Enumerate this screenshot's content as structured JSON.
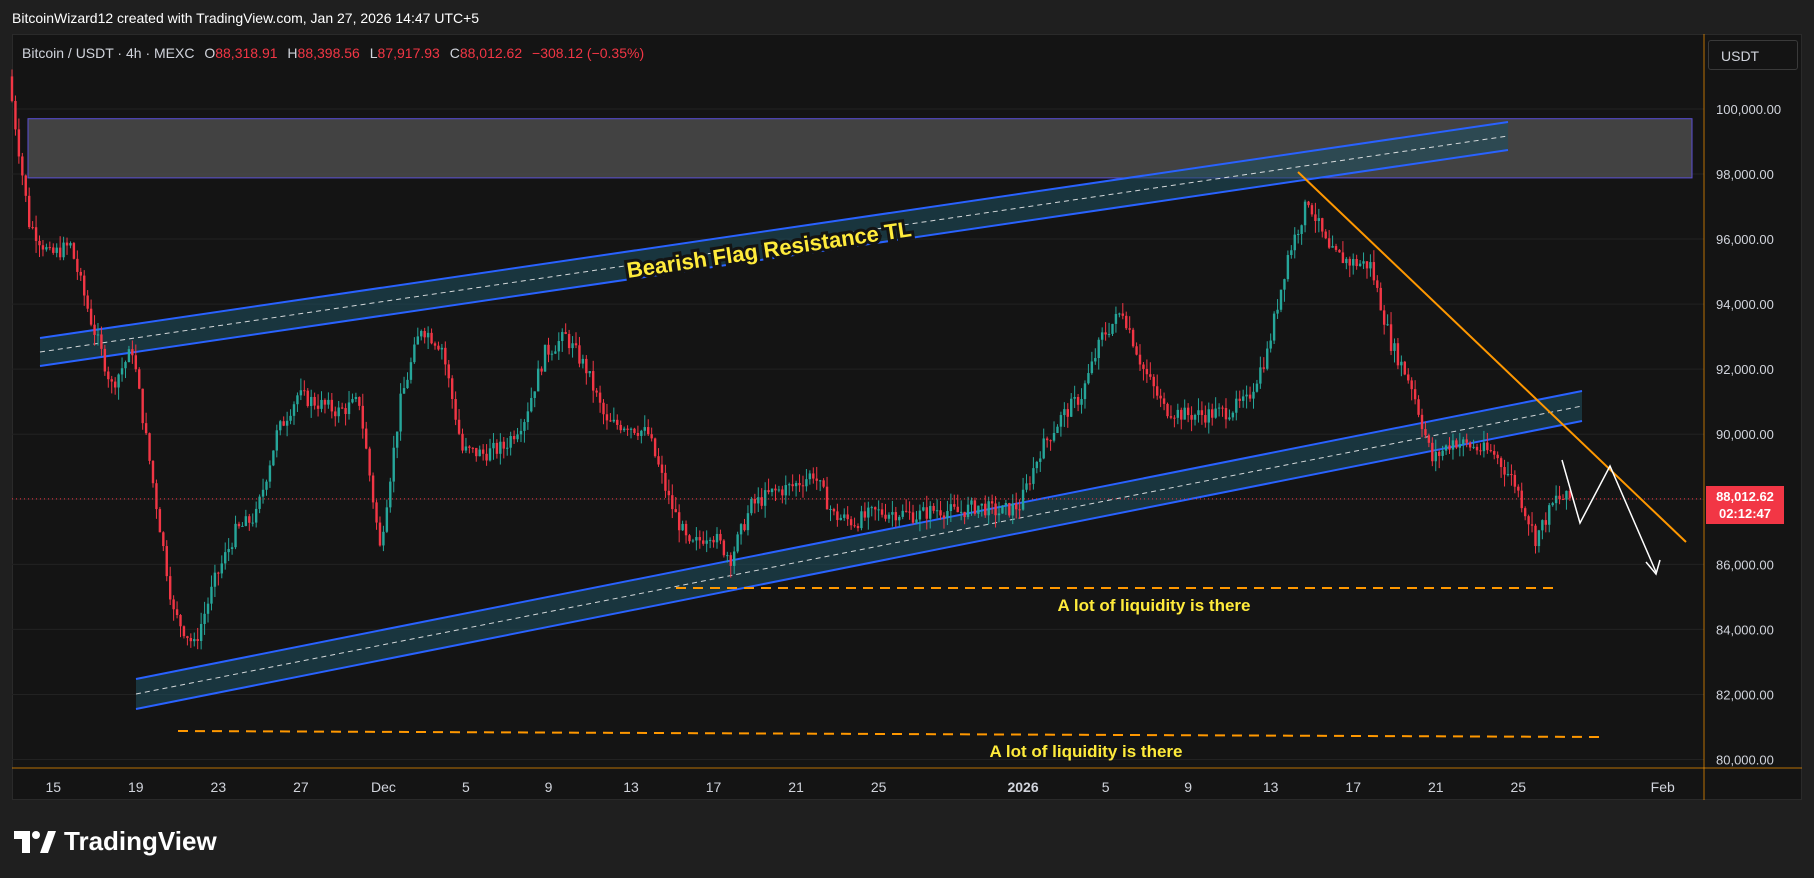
{
  "header": {
    "text": "BitcoinWizard12 created with TradingView.com, Jan 27, 2026 14:47 UTC+5"
  },
  "legend": {
    "symbol": "Bitcoin / USDT · 4h · MEXC",
    "open_label": "O",
    "open": "88,318.91",
    "high_label": "H",
    "high": "88,398.56",
    "low_label": "L",
    "low": "87,917.93",
    "close_label": "C",
    "close": "88,012.62",
    "change": "−308.12 (−0.35%)"
  },
  "currency": "USDT",
  "price_tag": {
    "price": "88,012.62",
    "countdown": "02:12:47"
  },
  "brand": {
    "name": "TradingView"
  },
  "colors": {
    "up": "#26a69a",
    "down": "#f23645",
    "channel": "#2962ff",
    "channel_fill": "#1e5060",
    "zone_fill": "#4a4a4a",
    "zone_border": "#5b4fd6",
    "trendline": "#ff9800",
    "liquidity": "#ff9800",
    "annotation_text": "#ffeb3b",
    "projection": "#ffffff"
  },
  "annotations": {
    "resistance_label": "Bearish Flag Resistance TL",
    "liquidity_label_1": "A lot of liquidity is there",
    "liquidity_label_2": "A lot of liquidity is there"
  },
  "chart_data": {
    "type": "candlestick",
    "title": "Bitcoin / USDT · 4h · MEXC",
    "interval": "4h",
    "y_ticks": [
      100000,
      98000,
      96000,
      94000,
      92000,
      90000,
      88000,
      86000,
      84000,
      82000,
      80000
    ],
    "y_tick_labels": [
      "100,000.00",
      "98,000.00",
      "96,000.00",
      "94,000.00",
      "92,000.00",
      "90,000.00",
      "88,000.00",
      "86,000.00",
      "84,000.00",
      "82,000.00",
      "80,000.00"
    ],
    "ylim": [
      79700,
      101300
    ],
    "x_ticks": [
      {
        "date": "2025-11-15",
        "label": "15"
      },
      {
        "date": "2025-11-19",
        "label": "19"
      },
      {
        "date": "2025-11-23",
        "label": "23"
      },
      {
        "date": "2025-11-27",
        "label": "27"
      },
      {
        "date": "2025-12-01",
        "label": "Dec"
      },
      {
        "date": "2025-12-05",
        "label": "5"
      },
      {
        "date": "2025-12-09",
        "label": "9"
      },
      {
        "date": "2025-12-13",
        "label": "13"
      },
      {
        "date": "2025-12-17",
        "label": "17"
      },
      {
        "date": "2025-12-21",
        "label": "21"
      },
      {
        "date": "2025-12-25",
        "label": "25"
      },
      {
        "date": "2026-01-01",
        "label": "2026"
      },
      {
        "date": "2026-01-05",
        "label": "5"
      },
      {
        "date": "2026-01-09",
        "label": "9"
      },
      {
        "date": "2026-01-13",
        "label": "13"
      },
      {
        "date": "2026-01-17",
        "label": "17"
      },
      {
        "date": "2026-01-21",
        "label": "21"
      },
      {
        "date": "2026-01-25",
        "label": "25"
      },
      {
        "date": "2026-02-01",
        "label": "Feb"
      }
    ],
    "xlim": [
      "2025-11-13",
      "2026-02-03"
    ],
    "last_price": 88012.62,
    "price_path": [
      [
        "2025-11-13",
        101000
      ],
      [
        "2025-11-14",
        96500
      ],
      [
        "2025-11-15",
        95500
      ],
      [
        "2025-11-16",
        95800
      ],
      [
        "2025-11-17",
        93500
      ],
      [
        "2025-11-18",
        91500
      ],
      [
        "2025-11-19",
        92600
      ],
      [
        "2025-11-20",
        88500
      ],
      [
        "2025-11-21",
        84500
      ],
      [
        "2025-11-22",
        83500
      ],
      [
        "2025-11-23",
        85500
      ],
      [
        "2025-11-24",
        87000
      ],
      [
        "2025-11-25",
        87500
      ],
      [
        "2025-11-26",
        90000
      ],
      [
        "2025-11-27",
        91200
      ],
      [
        "2025-11-29",
        90700
      ],
      [
        "2025-11-30",
        91000
      ],
      [
        "2025-12-01",
        86500
      ],
      [
        "2025-12-02",
        91000
      ],
      [
        "2025-12-03",
        93300
      ],
      [
        "2025-12-04",
        92700
      ],
      [
        "2025-12-05",
        89500
      ],
      [
        "2025-12-06",
        89400
      ],
      [
        "2025-12-07",
        89600
      ],
      [
        "2025-12-08",
        90500
      ],
      [
        "2025-12-09",
        92500
      ],
      [
        "2025-12-10",
        93000
      ],
      [
        "2025-12-11",
        92000
      ],
      [
        "2025-12-12",
        90300
      ],
      [
        "2025-12-13",
        90300
      ],
      [
        "2025-12-14",
        90000
      ],
      [
        "2025-12-15",
        88000
      ],
      [
        "2025-12-16",
        86500
      ],
      [
        "2025-12-17",
        87000
      ],
      [
        "2025-12-18",
        86200
      ],
      [
        "2025-12-19",
        87800
      ],
      [
        "2025-12-20",
        88200
      ],
      [
        "2025-12-21",
        88400
      ],
      [
        "2025-12-22",
        88800
      ],
      [
        "2025-12-23",
        87500
      ],
      [
        "2025-12-24",
        87300
      ],
      [
        "2025-12-25",
        87600
      ],
      [
        "2025-12-26",
        87600
      ],
      [
        "2025-12-27",
        87500
      ],
      [
        "2025-12-28",
        87700
      ],
      [
        "2025-12-29",
        87600
      ],
      [
        "2025-12-30",
        87800
      ],
      [
        "2025-12-31",
        87600
      ],
      [
        "2026-01-01",
        87800
      ],
      [
        "2026-01-02",
        89500
      ],
      [
        "2026-01-03",
        90500
      ],
      [
        "2026-01-04",
        91200
      ],
      [
        "2026-01-05",
        93000
      ],
      [
        "2026-01-06",
        93800
      ],
      [
        "2026-01-07",
        92000
      ],
      [
        "2026-01-08",
        90800
      ],
      [
        "2026-01-09",
        90600
      ],
      [
        "2026-01-10",
        90600
      ],
      [
        "2026-01-11",
        90700
      ],
      [
        "2026-01-12",
        91000
      ],
      [
        "2026-01-13",
        92500
      ],
      [
        "2026-01-14",
        95500
      ],
      [
        "2026-01-15",
        97200
      ],
      [
        "2026-01-16",
        95600
      ],
      [
        "2026-01-17",
        95300
      ],
      [
        "2026-01-18",
        95200
      ],
      [
        "2026-01-19",
        92800
      ],
      [
        "2026-01-20",
        91500
      ],
      [
        "2026-01-21",
        89200
      ],
      [
        "2026-01-22",
        89800
      ],
      [
        "2026-01-23",
        89600
      ],
      [
        "2026-01-24",
        89400
      ],
      [
        "2026-01-25",
        88500
      ],
      [
        "2026-01-26",
        86800
      ],
      [
        "2026-01-27",
        88012.62
      ]
    ]
  }
}
